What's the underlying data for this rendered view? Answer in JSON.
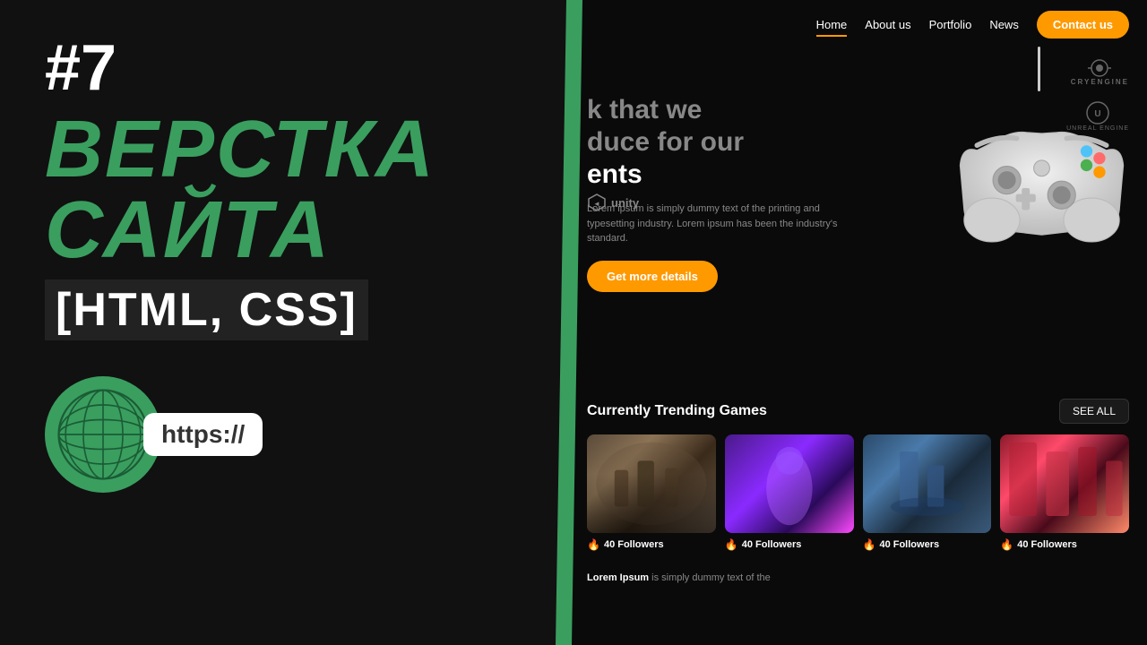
{
  "left": {
    "episode": "#7",
    "title_line1": "ВЕРСТКА",
    "title_line2": "САЙТА",
    "subtitle": "[HTML, CSS]",
    "https_label": "https://"
  },
  "nav": {
    "items": [
      {
        "label": "Home",
        "active": true
      },
      {
        "label": "About us",
        "active": false
      },
      {
        "label": "Portfolio",
        "active": false
      },
      {
        "label": "News",
        "active": false
      }
    ],
    "contact_label": "Contact us"
  },
  "hero": {
    "title": "work that we produce for our clients",
    "description": "Lorem ipsum is simply dummy text of the printing and typesetting industry. Lorem ipsum has been the industry's standard.",
    "cta_label": "Get more details",
    "engines": [
      "CRYENGINE",
      "UNREAL ENGINE",
      "unity"
    ]
  },
  "trending": {
    "section_title": "Currently Trending Games",
    "see_all_label": "SEE ALL",
    "games": [
      {
        "followers": "40 Followers"
      },
      {
        "followers": "40 Followers"
      },
      {
        "followers": "40 Followers"
      },
      {
        "followers": "40 Followers"
      }
    ]
  },
  "bottom": {
    "text": "Lorem ipsum is simply dummy text of the"
  }
}
